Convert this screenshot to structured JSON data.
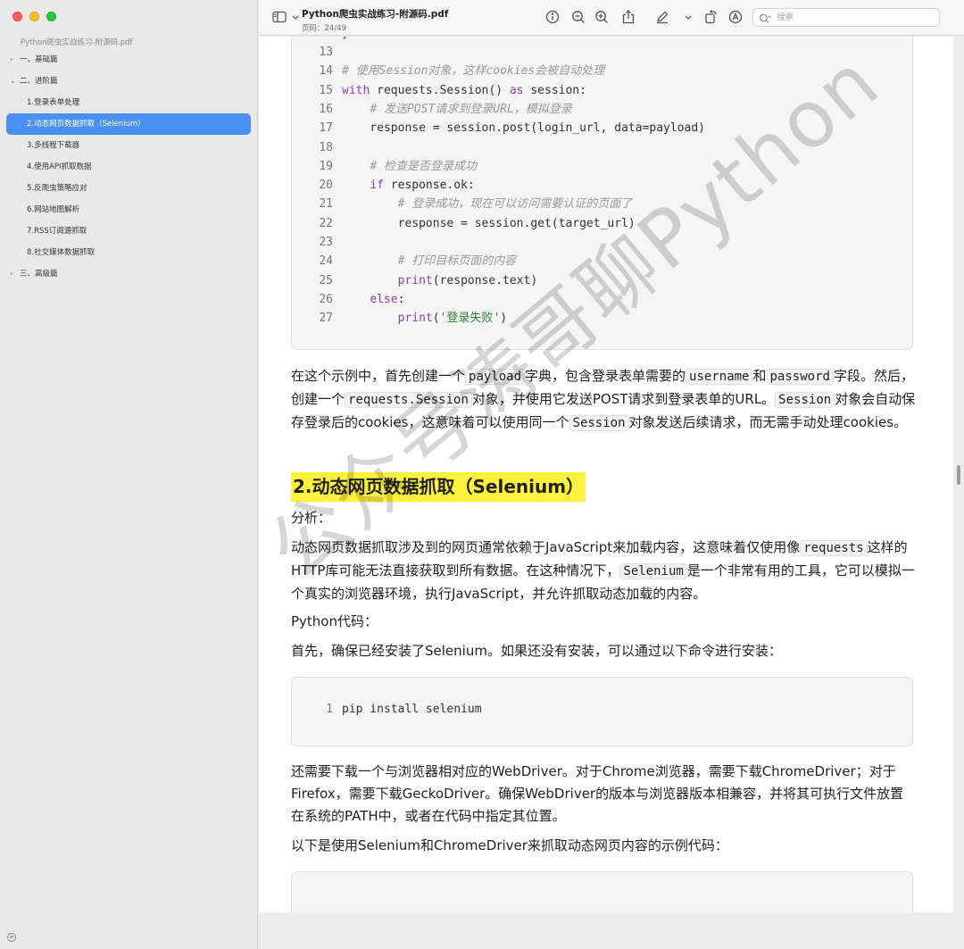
{
  "window": {
    "title": "Python爬虫实战练习-附源码.pdf",
    "page_label": "页码：24/49"
  },
  "search": {
    "placeholder": "搜索"
  },
  "sidebar": {
    "doc_name": "Python爬虫实战练习-附源码.pdf",
    "items": [
      {
        "label": "一、基础篇",
        "level": 1,
        "expanded": false
      },
      {
        "label": "二、进阶篇",
        "level": 1,
        "expanded": true
      },
      {
        "label": "1.登录表单处理",
        "level": 2
      },
      {
        "label": "2.动态网页数据抓取（Selenium）",
        "level": 2,
        "selected": true
      },
      {
        "label": "3.多线程下载器",
        "level": 2
      },
      {
        "label": "4.使用API抓取数据",
        "level": 2
      },
      {
        "label": "5.反爬虫策略应对",
        "level": 2
      },
      {
        "label": "6.网站地图解析",
        "level": 2
      },
      {
        "label": "7.RSS订阅源抓取",
        "level": 2
      },
      {
        "label": "8.社交媒体数据抓取",
        "level": 2
      },
      {
        "label": "三、高级篇",
        "level": 1,
        "expanded": false
      }
    ]
  },
  "colors": {
    "selection": "#4a8ff3",
    "highlight": "#fff23f",
    "keyword": "#8e3fa8",
    "comment": "#999999",
    "string": "#2e7d32"
  },
  "icons": [
    "sidebar-toggle-icon",
    "info-icon",
    "zoom-out-icon",
    "zoom-in-icon",
    "share-icon",
    "markup-pen-icon",
    "chevron-down-icon",
    "rotate-icon",
    "annotate-icon",
    "search-icon"
  ],
  "content": {
    "code1": {
      "top_partial": "}",
      "lines": [
        {
          "n": "13",
          "t": ""
        },
        {
          "n": "14",
          "t": "# 使用Session对象，这样cookies会被自动处理"
        },
        {
          "n": "15",
          "t": "with requests.Session() as session:"
        },
        {
          "n": "16",
          "t": "    # 发送POST请求到登录URL，模拟登录"
        },
        {
          "n": "17",
          "t": "    response = session.post(login_url, data=payload)"
        },
        {
          "n": "18",
          "t": ""
        },
        {
          "n": "19",
          "t": "    # 检查是否登录成功"
        },
        {
          "n": "20",
          "t": "    if response.ok:"
        },
        {
          "n": "21",
          "t": "        # 登录成功，现在可以访问需要认证的页面了"
        },
        {
          "n": "22",
          "t": "        response = session.get(target_url)"
        },
        {
          "n": "23",
          "t": ""
        },
        {
          "n": "24",
          "t": "        # 打印目标页面的内容"
        },
        {
          "n": "25",
          "t": "        print(response.text)"
        },
        {
          "n": "26",
          "t": "    else:"
        },
        {
          "n": "27",
          "t": "        print('登录失败')"
        }
      ]
    },
    "para1": {
      "s1": "在这个示例中，首先创建一个",
      "c1": "payload",
      "s2": "字典，包含登录表单需要的",
      "c2": "username",
      "s3": "和",
      "c3": "password",
      "s4": "字段。然后，创建一个",
      "c4": "requests.Session",
      "s5": "对象，并使用它发送POST请求到登录表单的URL。",
      "c5": "Session",
      "s6": "对象会自动保存登录后的cookies，这意味着可以使用同一个",
      "c6": "Session",
      "s7": "对象发送后续请求，而无需手动处理cookies。"
    },
    "heading": "2.动态网页数据抓取（Selenium）",
    "analysis_label": "分析：",
    "para2": {
      "s1": "动态网页数据抓取涉及到的网页通常依赖于JavaScript来加载内容，这意味着仅使用像",
      "c1": "requests",
      "s2": "这样的HTTP库可能无法直接获取到所有数据。在这种情况下，",
      "c2": "Selenium",
      "s3": "是一个非常有用的工具，它可以模拟一个真实的浏览器环境，执行JavaScript，并允许抓取动态加载的内容。"
    },
    "python_code_label": "Python代码：",
    "install_intro": "首先，确保已经安装了Selenium。如果还没有安装，可以通过以下命令进行安装：",
    "code2": {
      "lines": [
        {
          "n": "1",
          "t": "pip install selenium"
        }
      ]
    },
    "para3": "还需要下载一个与浏览器相对应的WebDriver。对于Chrome浏览器，需要下载ChromeDriver；对于Firefox，需要下载GeckoDriver。确保WebDriver的版本与浏览器版本相兼容，并将其可执行文件放置在系统的PATH中，或者在代码中指定其位置。",
    "para4": "以下是使用Selenium和ChromeDriver来抓取动态网页内容的示例代码："
  },
  "watermark": "公众号涛哥聊Python"
}
